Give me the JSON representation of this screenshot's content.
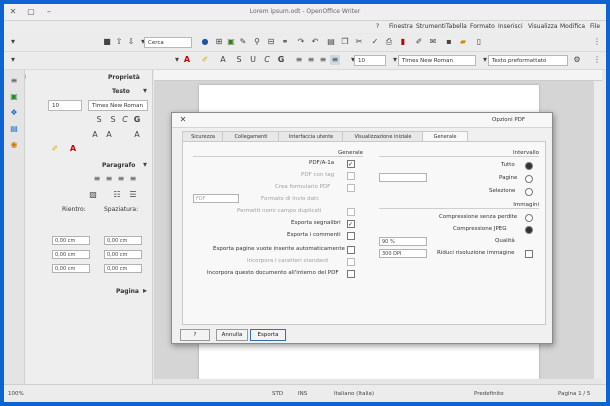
{
  "window": {
    "title": "Lorem ipsum.odt - OpenOffice Writer"
  },
  "menu": [
    "File",
    "Modifica",
    "Visualizza",
    "Inserisci",
    "Formato",
    "Tabella",
    "Strumenti",
    "Finestra",
    "?"
  ],
  "toolbar": {
    "search_placeholder": "Cerca",
    "style_value": "Testo preformattato",
    "font_value": "Times New Roman",
    "size_value": "10"
  },
  "sidebar": {
    "title": "Proprietà",
    "text_section": "Testo",
    "font_value": "Times New Roman",
    "size_value": "10",
    "paragraph_section": "Paragrafo",
    "spacing_label": "Spaziatura:",
    "indent_label": "Rientro:",
    "spin_values": [
      "0,00 cm",
      "0,00 cm",
      "0,00 cm",
      "0,00 cm",
      "0,00 cm",
      "0,00 cm"
    ],
    "page_section": "Pagina"
  },
  "dialog": {
    "title": "Opzioni PDF",
    "tabs": [
      "Generale",
      "Visualizzazione iniziale",
      "Interfaccia utente",
      "Collegamenti",
      "Sicurezza"
    ],
    "range": {
      "heading": "Intervallo",
      "options": [
        "Tutto",
        "Pagine",
        "Selezione"
      ],
      "pages_value": ""
    },
    "images": {
      "heading": "Immagini",
      "lossless": "Compressione senza perdite",
      "jpeg": "Compressione JPEG",
      "quality_label": "Qualità",
      "quality_value": "90 %",
      "reduce_label": "Riduci risoluzione immagine",
      "dpi_value": "300 DPI"
    },
    "general": {
      "heading": "Generale",
      "pdfa": "PDF/A-1a",
      "tagged": "PDF con tag",
      "create_form": "Crea formulario PDF",
      "submit_format_label": "Formato di invio dati:",
      "submit_format_value": "FDF",
      "allow_duplicate": "Permetti nomi campo duplicati",
      "export_bookmarks": "Esporta segnalibri",
      "export_comments": "Esporta i commenti",
      "export_blank": "Esporta pagine vuote inserite automaticamente",
      "embed_fonts": "Incorpora i caratteri standard",
      "embed_odf": "Incorpora questo documento all'interno del PDF"
    },
    "buttons": {
      "export": "Esporta",
      "cancel": "Annulla",
      "help": "?"
    }
  },
  "statusbar": {
    "page": "Pagina 1 / 5",
    "style": "Predefinito",
    "language": "Italiano (Italia)",
    "insert_mode": "INS",
    "selection": "STD",
    "zoom": "100%"
  }
}
